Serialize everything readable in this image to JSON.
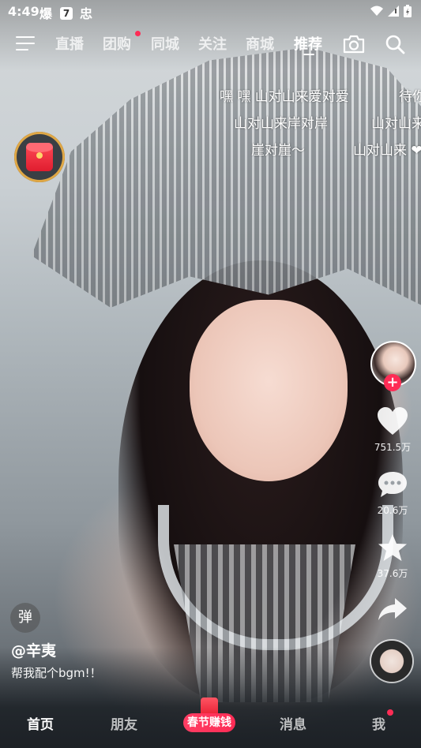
{
  "status_bar": {
    "time": "4:49",
    "icon_1": "爆",
    "icon_2": "7",
    "icon_3": "忠"
  },
  "top_nav": {
    "tabs": [
      {
        "label": "直播"
      },
      {
        "label": "团购",
        "has_dot": true
      },
      {
        "label": "同城"
      },
      {
        "label": "关注"
      },
      {
        "label": "商城"
      },
      {
        "label": "推荐",
        "active": true
      }
    ]
  },
  "danmaku": [
    "嘿  嘿 山对山来爱对爱",
    "待你",
    "山对山来岸对岸",
    "山对山来",
    "崖对崖～",
    "山对山来 ❤"
  ],
  "actions": {
    "likes": "751.5万",
    "comments": "20.6万",
    "favorites": "37.6万"
  },
  "post": {
    "danmu_toggle": "弹",
    "username": "@辛夷",
    "caption": "帮我配个bgm!！"
  },
  "bottom_tabs": {
    "home": "首页",
    "friends": "朋友",
    "festival": "春节赚钱",
    "messages": "消息",
    "me": "我"
  },
  "colors": {
    "accent": "#fe2c55",
    "red_packet": "#e01d2f"
  }
}
